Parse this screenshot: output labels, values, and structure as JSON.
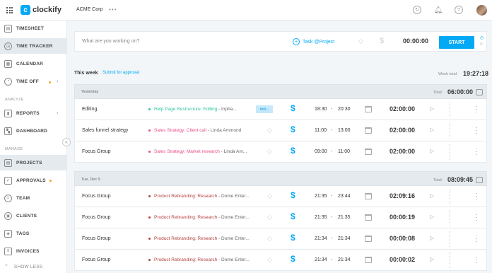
{
  "topbar": {
    "app_name": "clockify",
    "logo_letter": "c",
    "workspace": "ACME Corp",
    "workspace_more": "•••"
  },
  "sidebar": {
    "items": [
      {
        "label": "TIMESHEET",
        "icon": "timesheet-icon"
      },
      {
        "label": "TIME TRACKER",
        "icon": "clock-icon"
      },
      {
        "label": "CALENDAR",
        "icon": "calendar-icon"
      },
      {
        "label": "TIME OFF",
        "icon": "time-off-icon"
      },
      {
        "label": "REPORTS",
        "icon": "reports-icon"
      },
      {
        "label": "DASHBOARD",
        "icon": "dashboard-icon"
      },
      {
        "label": "PROJECTS",
        "icon": "projects-icon"
      },
      {
        "label": "APPROVALS",
        "icon": "approvals-icon"
      },
      {
        "label": "TEAM",
        "icon": "team-icon"
      },
      {
        "label": "CLIENTS",
        "icon": "clients-icon"
      },
      {
        "label": "TAGS",
        "icon": "tag-icon"
      },
      {
        "label": "INVOICES",
        "icon": "invoices-icon"
      }
    ],
    "section_analyze": "ANALYZE",
    "section_manage": "MANAGE",
    "show_less": "SHOW LESS",
    "active": "TIME TRACKER"
  },
  "timer": {
    "placeholder": "What are you working on?",
    "task_project": "Task @Project",
    "time": "00:00:00",
    "start_label": "START"
  },
  "week": {
    "title": "This week",
    "submit_label": "Submit for approval",
    "total_label": "Week total:",
    "total_value": "19:27:18"
  },
  "days": [
    {
      "label": "Yesterday",
      "total_label": "Total:",
      "total": "06:00:00",
      "entries": [
        {
          "desc": "Editing",
          "project": "Help Page Restructure: Editing",
          "client": "Inpha...",
          "color": "#2ec4a0",
          "tag": "#cli...",
          "start": "18:30",
          "end": "20:30",
          "duration": "02:00:00"
        },
        {
          "desc": "Sales funnel strategy",
          "project": "Sales Strategy: Client call",
          "client": "Linda Ammond",
          "color": "#e84b8a",
          "tag": "",
          "start": "11:00",
          "end": "13:00",
          "duration": "02:00:00"
        },
        {
          "desc": "Focus Group",
          "project": "Sales Strategy: Market research",
          "client": "Linda Am...",
          "color": "#e84b8a",
          "tag": "",
          "start": "09:00",
          "end": "11:00",
          "duration": "02:00:00"
        }
      ]
    },
    {
      "label": "Tue, Dec 9",
      "total_label": "Total:",
      "total": "08:09:45",
      "entries": [
        {
          "desc": "Focus Group",
          "project": "Product Rebranding: Research",
          "client": "Dome Enter...",
          "color": "#b0413e",
          "tag": "",
          "start": "21:35",
          "end": "23:44",
          "duration": "02:09:16"
        },
        {
          "desc": "Focus Group",
          "project": "Product Rebranding: Research",
          "client": "Dome Enter...",
          "color": "#b0413e",
          "tag": "",
          "start": "21:35",
          "end": "21:35",
          "duration": "00:00:19"
        },
        {
          "desc": "Focus Group",
          "project": "Product Rebranding: Research",
          "client": "Dome Enter...",
          "color": "#b0413e",
          "tag": "",
          "start": "21:34",
          "end": "21:34",
          "duration": "00:00:08"
        },
        {
          "desc": "Focus Group",
          "project": "Product Rebranding: Research",
          "client": "Dome Enter...",
          "color": "#b0413e",
          "tag": "",
          "start": "21:34",
          "end": "21:34",
          "duration": "00:00:02"
        }
      ]
    }
  ],
  "colors": {
    "accent": "#03a9f4",
    "status_dot": "#f5a623"
  }
}
